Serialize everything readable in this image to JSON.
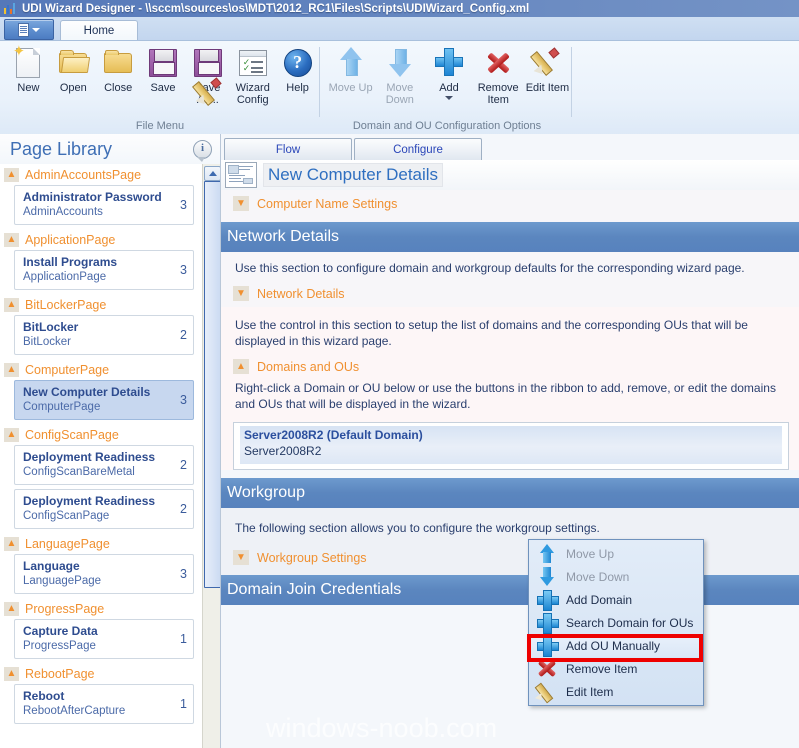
{
  "window": {
    "title": "UDI Wizard Designer - \\\\sccm\\sources\\os\\MDT\\2012_RC1\\Files\\Scripts\\UDIWizard_Config.xml",
    "titlebar_color": "#5a7fbd"
  },
  "ribbon": {
    "office_button": "File",
    "tabs": [
      {
        "label": "Home",
        "active": true
      }
    ],
    "groups": [
      {
        "title": "File Menu",
        "buttons": [
          {
            "label": "New",
            "icon": "new-document-icon",
            "disabled": false
          },
          {
            "label": "Open",
            "icon": "open-folder-icon",
            "disabled": false
          },
          {
            "label": "Close",
            "icon": "folder-icon",
            "disabled": false
          },
          {
            "label": "Save",
            "icon": "floppy-disk-icon",
            "disabled": false
          },
          {
            "label": "Save As...",
            "icon": "floppy-disk-pencil-icon",
            "disabled": false
          },
          {
            "label": "Wizard Config",
            "icon": "wizard-config-icon",
            "disabled": false
          },
          {
            "label": "Help",
            "icon": "help-question-icon",
            "disabled": false
          }
        ]
      },
      {
        "title": "Domain and OU Configuration Options",
        "buttons": [
          {
            "label": "Move Up",
            "icon": "arrow-up-icon",
            "disabled": true
          },
          {
            "label": "Move Down",
            "icon": "arrow-down-icon",
            "disabled": true
          },
          {
            "label": "Add",
            "icon": "plus-icon",
            "disabled": false,
            "has_dropdown": true
          },
          {
            "label": "Remove Item",
            "icon": "red-x-icon",
            "disabled": false
          },
          {
            "label": "Edit Item",
            "icon": "pencil-icon",
            "disabled": false
          }
        ]
      }
    ]
  },
  "sidebar": {
    "title": "Page Library",
    "info_icon": "info-icon",
    "groups": [
      {
        "name": "AdminAccountsPage",
        "pages": [
          {
            "title": "Administrator Password",
            "subtitle": "AdminAccounts",
            "count": "3",
            "selected": false
          }
        ]
      },
      {
        "name": "ApplicationPage",
        "pages": [
          {
            "title": "Install Programs",
            "subtitle": "ApplicationPage",
            "count": "3",
            "selected": false
          }
        ]
      },
      {
        "name": "BitLockerPage",
        "pages": [
          {
            "title": "BitLocker",
            "subtitle": "BitLocker",
            "count": "2",
            "selected": false
          }
        ]
      },
      {
        "name": "ComputerPage",
        "pages": [
          {
            "title": "New Computer Details",
            "subtitle": "ComputerPage",
            "count": "3",
            "selected": true
          }
        ]
      },
      {
        "name": "ConfigScanPage",
        "pages": [
          {
            "title": "Deployment Readiness",
            "subtitle": "ConfigScanBareMetal",
            "count": "2",
            "selected": false
          },
          {
            "title": "Deployment Readiness",
            "subtitle": "ConfigScanPage",
            "count": "2",
            "selected": false
          }
        ]
      },
      {
        "name": "LanguagePage",
        "pages": [
          {
            "title": "Language",
            "subtitle": "LanguagePage",
            "count": "3",
            "selected": false
          }
        ]
      },
      {
        "name": "ProgressPage",
        "pages": [
          {
            "title": "Capture Data",
            "subtitle": "ProgressPage",
            "count": "1",
            "selected": false
          }
        ]
      },
      {
        "name": "RebootPage",
        "pages": [
          {
            "title": "Reboot",
            "subtitle": "RebootAfterCapture",
            "count": "1",
            "selected": false
          }
        ]
      }
    ]
  },
  "main": {
    "tabs": [
      {
        "label": "Flow"
      },
      {
        "label": "Configure"
      }
    ],
    "page_title": "New Computer Details",
    "collapse_computer_name": "Computer Name Settings",
    "section_network": "Network Details",
    "network_intro": "Use this section to configure domain and workgroup defaults for the corresponding wizard page.",
    "collapse_network": "Network Details",
    "domains_intro": "Use the control in this section to setup the list of domains and the corresponding OUs that will be displayed in this wizard page.",
    "collapse_domains": "Domains and OUs",
    "domains_help": "Right-click a Domain or OU below or use the buttons in the ribbon to add, remove, or edit the domains and OUs that will be displayed in the wizard.",
    "domain_list": [
      {
        "name": "Server2008R2 (Default Domain)",
        "value": "Server2008R2",
        "selected": true
      }
    ],
    "section_workgroup": "Workgroup",
    "workgroup_intro": "The following section allows you to configure the workgroup settings.",
    "collapse_workgroup": "Workgroup Settings",
    "section_domain_join": "Domain Join Credentials",
    "header_color": "#5b87bf",
    "link_color": "#2f6fc0",
    "collapse_label_color": "#f09030"
  },
  "context_menu": {
    "items": [
      {
        "label": "Move Up",
        "icon": "arrow-up-icon",
        "disabled": true,
        "highlighted": false
      },
      {
        "label": "Move Down",
        "icon": "arrow-down-icon",
        "disabled": true,
        "highlighted": false
      },
      {
        "label": "Add Domain",
        "icon": "plus-icon",
        "disabled": false,
        "highlighted": false
      },
      {
        "label": "Search Domain for OUs",
        "icon": "plus-icon",
        "disabled": false,
        "highlighted": false
      },
      {
        "label": "Add OU Manually",
        "icon": "plus-icon",
        "disabled": false,
        "highlighted": true
      },
      {
        "label": "Remove Item",
        "icon": "red-x-icon",
        "disabled": false,
        "highlighted": false
      },
      {
        "label": "Edit Item",
        "icon": "pencil-icon",
        "disabled": false,
        "highlighted": false
      }
    ],
    "highlight_color": "#ee0000"
  },
  "watermark": "windows-noob.com"
}
